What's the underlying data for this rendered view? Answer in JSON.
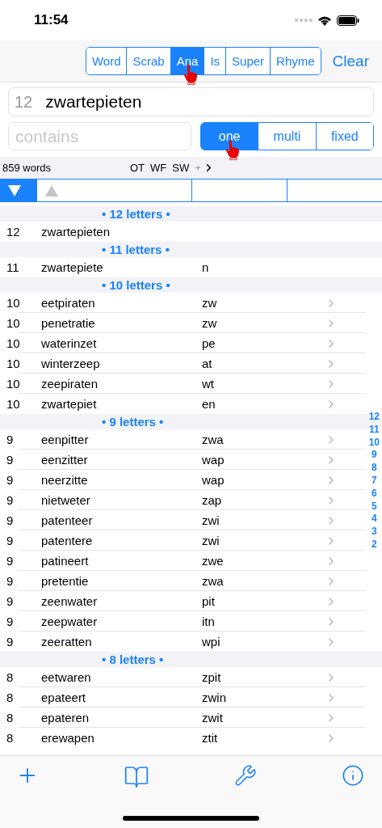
{
  "status_bar": {
    "time": "11:54"
  },
  "modes": [
    {
      "label": "Word",
      "selected": false
    },
    {
      "label": "Scrab",
      "selected": false
    },
    {
      "label": "Ana",
      "selected": true
    },
    {
      "label": "Is",
      "selected": false
    },
    {
      "label": "Super",
      "selected": false
    },
    {
      "label": "Rhyme",
      "selected": false
    }
  ],
  "clear": "Clear",
  "query": {
    "length": "12",
    "value": "zwartepieten"
  },
  "contains": {
    "placeholder": "contains"
  },
  "match": [
    {
      "label": "one",
      "selected": true
    },
    {
      "label": "multi",
      "selected": false
    },
    {
      "label": "fixed",
      "selected": false
    }
  ],
  "info": {
    "count": "859 words",
    "filters": [
      "OT",
      "WF",
      "SW"
    ],
    "plus": "+"
  },
  "header_cells": [
    {
      "kind": "down",
      "selected": true
    },
    {
      "kind": "up",
      "selected": false
    },
    {
      "kind": "blank",
      "selected": false
    },
    {
      "kind": "blank",
      "selected": false
    }
  ],
  "groups": [
    {
      "title": "• 12 letters •",
      "rows": [
        {
          "length": "12",
          "word": "zwartepieten",
          "chevron": false
        }
      ]
    },
    {
      "title": "• 11 letters •",
      "rows": [
        {
          "length": "11",
          "word": "zwartepiete",
          "rest": "n",
          "chevron": false
        }
      ]
    },
    {
      "title": "• 10 letters •",
      "rows": [
        {
          "length": "10",
          "word": "eetpiraten",
          "rest": "zw",
          "chevron": true
        },
        {
          "length": "10",
          "word": "penetratie",
          "rest": "zw",
          "chevron": true
        },
        {
          "length": "10",
          "word": "waterinzet",
          "rest": "pe",
          "chevron": true
        },
        {
          "length": "10",
          "word": "winterzeep",
          "rest": "at",
          "chevron": true
        },
        {
          "length": "10",
          "word": "zeepiraten",
          "rest": "wt",
          "chevron": true
        },
        {
          "length": "10",
          "word": "zwartepiet",
          "rest": "en",
          "chevron": true
        }
      ]
    },
    {
      "title": "• 9 letters •",
      "rows": [
        {
          "length": "9",
          "word": "eenpitter",
          "rest": "zwa",
          "chevron": true
        },
        {
          "length": "9",
          "word": "eenzitter",
          "rest": "wap",
          "chevron": true
        },
        {
          "length": "9",
          "word": "neerzitte",
          "rest": "wap",
          "chevron": true
        },
        {
          "length": "9",
          "word": "nietweter",
          "rest": "zap",
          "chevron": true
        },
        {
          "length": "9",
          "word": "patenteer",
          "rest": "zwi",
          "chevron": true
        },
        {
          "length": "9",
          "word": "patentere",
          "rest": "zwi",
          "chevron": true
        },
        {
          "length": "9",
          "word": "patineert",
          "rest": "zwe",
          "chevron": true
        },
        {
          "length": "9",
          "word": "pretentie",
          "rest": "zwa",
          "chevron": true
        },
        {
          "length": "9",
          "word": "zeenwater",
          "rest": "pit",
          "chevron": true
        },
        {
          "length": "9",
          "word": "zeepwater",
          "rest": "itn",
          "chevron": true
        },
        {
          "length": "9",
          "word": "zeeratten",
          "rest": "wpi",
          "chevron": true
        }
      ]
    },
    {
      "title": "• 8 letters •",
      "rows": [
        {
          "length": "8",
          "word": "eetwaren",
          "rest": "zpit",
          "chevron": true
        },
        {
          "length": "8",
          "word": "epateert",
          "rest": "zwin",
          "chevron": true
        },
        {
          "length": "8",
          "word": "epateren",
          "rest": "zwit",
          "chevron": true
        },
        {
          "length": "8",
          "word": "erewapen",
          "rest": "ztit",
          "chevron": true
        }
      ]
    }
  ],
  "index": [
    "12",
    "11",
    "10",
    "9",
    "8",
    "7",
    "6",
    "5",
    "4",
    "3",
    "2"
  ]
}
